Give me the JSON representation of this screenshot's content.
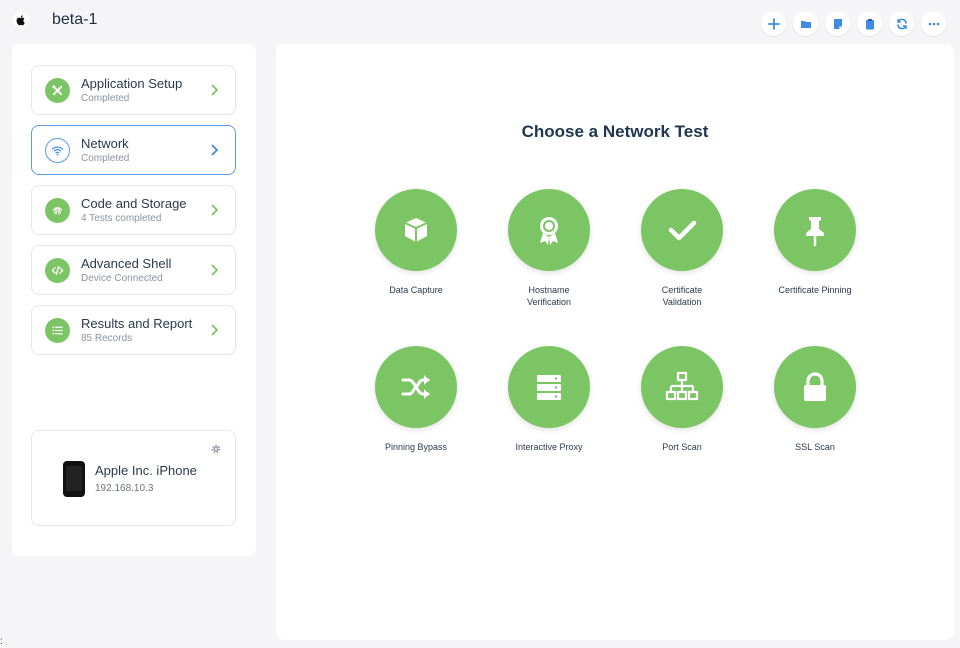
{
  "header": {
    "title": "beta-1",
    "logo": "apple-logo",
    "toolbar": [
      "plus-icon",
      "folder-icon",
      "note-icon",
      "clipboard-icon",
      "refresh-icon",
      "more-icon"
    ]
  },
  "sidebar": {
    "steps": [
      {
        "title": "Application Setup",
        "subtitle": "Completed",
        "icon": "tools-icon"
      },
      {
        "title": "Network",
        "subtitle": "Completed",
        "icon": "wifi-icon",
        "active": true
      },
      {
        "title": "Code and Storage",
        "subtitle": "4 Tests completed",
        "icon": "fingerprint-icon"
      },
      {
        "title": "Advanced Shell",
        "subtitle": "Device Connected",
        "icon": "code-icon"
      },
      {
        "title": "Results and Report",
        "subtitle": "85 Records",
        "icon": "list-icon"
      }
    ],
    "device": {
      "name": "Apple Inc. iPhone",
      "ip": "192.168.10.3"
    }
  },
  "main": {
    "title": "Choose a Network Test",
    "tests": [
      {
        "label": "Data Capture",
        "icon": "box-icon"
      },
      {
        "label": "Hostname\nVerification",
        "icon": "award-icon"
      },
      {
        "label": "Certificate\nValidation",
        "icon": "check-icon"
      },
      {
        "label": "Certificate Pinning",
        "icon": "pin-icon"
      },
      {
        "label": "Pinning Bypass",
        "icon": "shuffle-icon"
      },
      {
        "label": "Interactive Proxy",
        "icon": "server-icon"
      },
      {
        "label": "Port Scan",
        "icon": "network-icon"
      },
      {
        "label": "SSL Scan",
        "icon": "lock-icon"
      }
    ]
  },
  "colors": {
    "accent_green": "#7cc564",
    "accent_blue": "#3f8de0",
    "title_navy": "#1f3550"
  },
  "misc": {
    "corner_mark": ":"
  }
}
